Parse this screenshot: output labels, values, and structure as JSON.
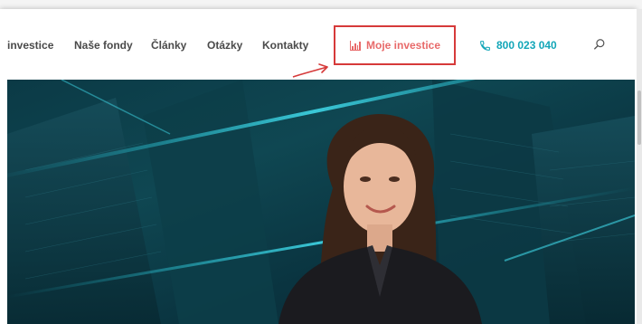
{
  "nav": {
    "items": [
      {
        "label": "investice"
      },
      {
        "label": "Naše fondy"
      },
      {
        "label": "Články"
      },
      {
        "label": "Otázky"
      },
      {
        "label": "Kontakty"
      }
    ],
    "cta_label": "Moje investice",
    "phone": "800 023 040"
  },
  "icons": {
    "cta": "bar-chart-icon",
    "phone": "phone-icon",
    "search": "search-icon",
    "annotation": "red-arrow"
  },
  "colors": {
    "nav_text": "#4a4a4a",
    "cta_text": "#e86a6a",
    "highlight_border": "#d63a3a",
    "phone_text": "#13a6b8",
    "hero_bg": "#0f4752"
  }
}
